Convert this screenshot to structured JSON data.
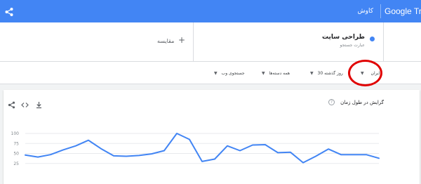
{
  "app": {
    "brand": "Google Trends",
    "tab_label": "کاوش",
    "accent": "#4285f4"
  },
  "terms": {
    "items": [
      {
        "name": "طراحی سایت",
        "type": "عبارت جستجو",
        "color": "#4285f4"
      }
    ],
    "compare_label": "مقایسه",
    "compare_icon": "plus-icon"
  },
  "filters": {
    "region": "ایران",
    "time": "30 روز گذشته",
    "category": "همه دسته‌ها",
    "search_type": "جستجوی وب"
  },
  "interest": {
    "title": "گرایش در طول زمان",
    "help_icon": "?"
  },
  "annotation": {
    "color": "#e00000"
  },
  "chart_data": {
    "type": "line",
    "y_ticks": [
      "100",
      "75",
      "50",
      "25"
    ],
    "ylim": [
      0,
      100
    ],
    "grid": true,
    "series": [
      {
        "color": "#4285f4",
        "values": [
          46,
          41,
          47,
          59,
          69,
          83,
          62,
          44,
          43,
          45,
          49,
          57,
          100,
          85,
          30,
          36,
          69,
          57,
          71,
          72,
          52,
          53,
          27,
          43,
          61,
          47,
          47,
          47,
          38
        ]
      }
    ]
  }
}
